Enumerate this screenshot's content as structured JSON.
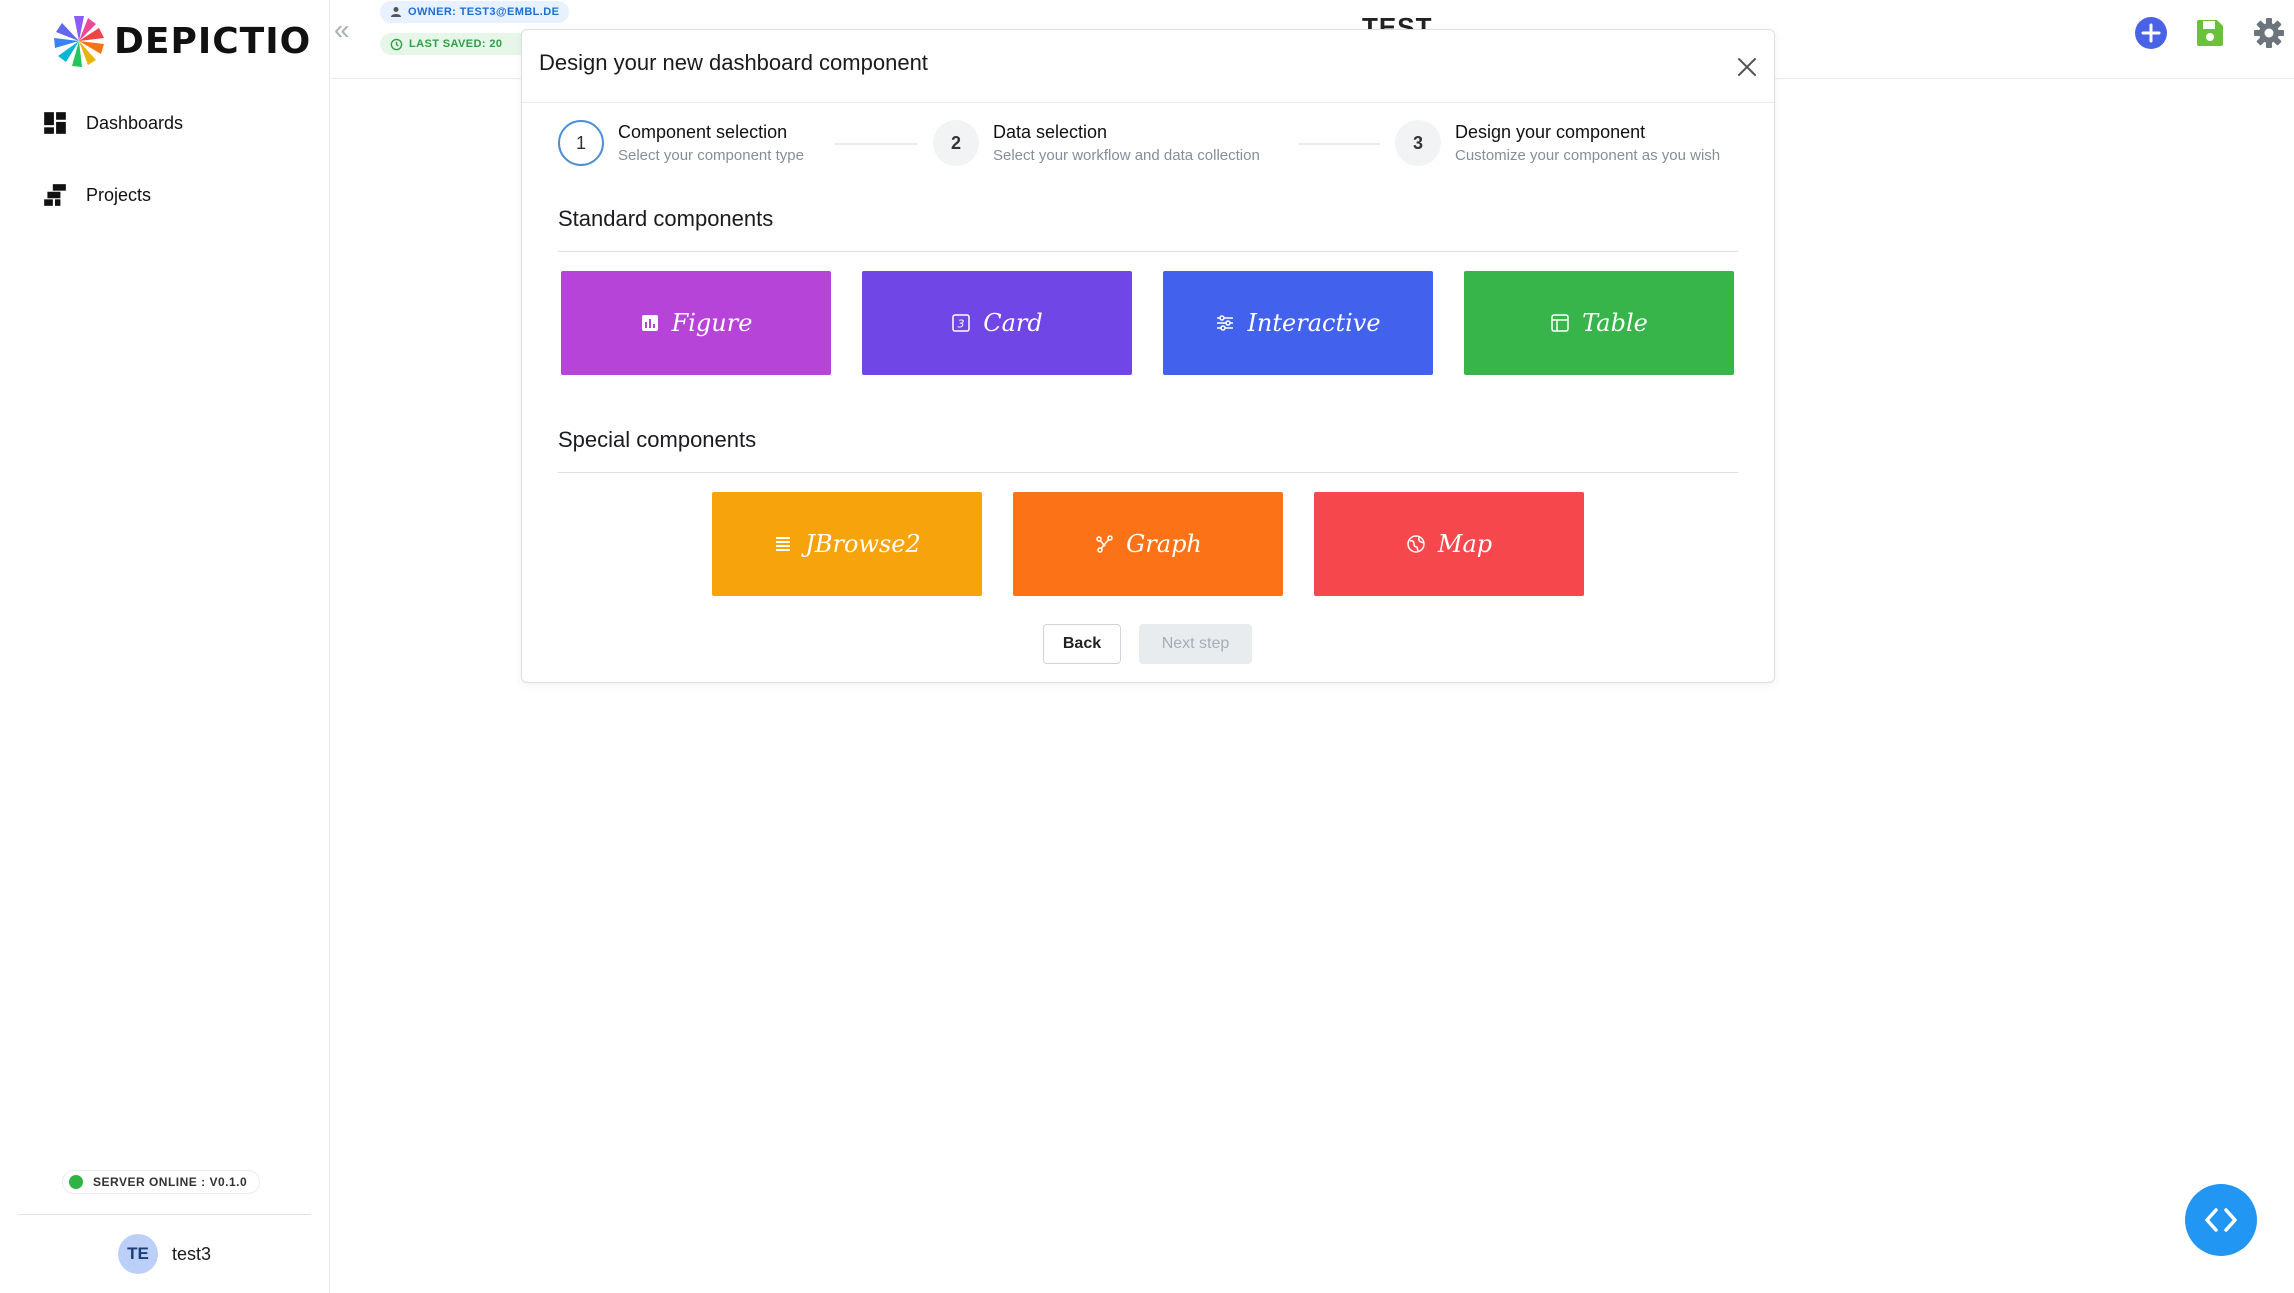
{
  "app": {
    "logo_text": "DEPICTIO"
  },
  "sidebar": {
    "items": [
      {
        "label": "Dashboards",
        "icon": "dashboard-grid-icon"
      },
      {
        "label": "Projects",
        "icon": "projects-stack-icon"
      }
    ],
    "server_status": "SERVER ONLINE : V0.1.0",
    "user": {
      "initials": "TE",
      "name": "test3"
    }
  },
  "header": {
    "owner_badge": "OWNER: TEST3@EMBL.DE",
    "last_saved_badge": "LAST SAVED: 20",
    "dashboard_title": "TEST",
    "actions": [
      "add-icon",
      "save-icon",
      "settings-gear-icon"
    ]
  },
  "modal": {
    "title": "Design your new dashboard component",
    "steps": [
      {
        "number": "1",
        "title": "Component selection",
        "description": "Select your component type"
      },
      {
        "number": "2",
        "title": "Data selection",
        "description": "Select your workflow and data collection"
      },
      {
        "number": "3",
        "title": "Design your component",
        "description": "Customize your component as you wish"
      }
    ],
    "standard_title": "Standard components",
    "standard_components": [
      {
        "label": "Figure",
        "color": "#b744d8",
        "icon": "bar-chart-icon"
      },
      {
        "label": "Card",
        "color": "#7146e6",
        "icon": "numbered-square-icon"
      },
      {
        "label": "Interactive",
        "color": "#4262ee",
        "icon": "sliders-icon"
      },
      {
        "label": "Table",
        "color": "#37b54a",
        "icon": "table-icon"
      }
    ],
    "special_title": "Special components",
    "special_components": [
      {
        "label": "JBrowse2",
        "color": "#f7a40c",
        "icon": "list-lines-icon"
      },
      {
        "label": "Graph",
        "color": "#fb7316",
        "icon": "network-graph-icon"
      },
      {
        "label": "Map",
        "color": "#f6474c",
        "icon": "globe-icon"
      }
    ],
    "back_label": "Back",
    "next_label": "Next step"
  },
  "colors": {
    "accent_blue": "#4a63e6",
    "save_green": "#69c23a",
    "server_online": "#2fb344",
    "fab_blue": "#2196f3"
  }
}
